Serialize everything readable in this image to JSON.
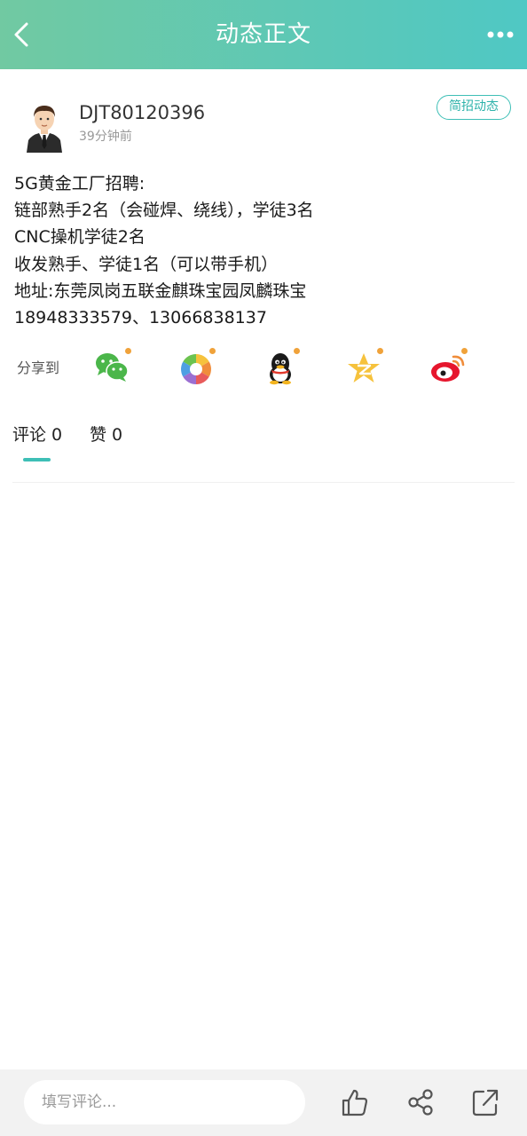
{
  "header": {
    "title": "动态正文",
    "back_icon": "chevron-left-icon",
    "more_icon": "more-dots-icon"
  },
  "post": {
    "author": "DJT80120396",
    "time": "39分钟前",
    "tag": "简招动态",
    "lines": [
      "5G黄金工厂招聘:",
      "链部熟手2名（会碰焊、绕线），学徒3名",
      "CNC操机学徒2名",
      "收发熟手、学徒1名（可以带手机）",
      "地址:东莞凤岗五联金麒珠宝园凤麟珠宝",
      "18948333579、13066838137"
    ]
  },
  "share": {
    "label": "分享到",
    "targets": [
      "wechat-icon",
      "moments-icon",
      "qq-icon",
      "qzone-icon",
      "weibo-icon"
    ]
  },
  "tabs": {
    "comments": "评论 0",
    "likes": "赞 0"
  },
  "bottom_bar": {
    "comment_placeholder": "填写评论...",
    "icons": [
      "thumbs-up-icon",
      "share-nodes-icon",
      "external-share-icon"
    ]
  },
  "colors": {
    "header_gradient_start": "#71c9a2",
    "header_gradient_end": "#4fc8c4",
    "accent": "#3ebfb6",
    "share_dot": "#f0a23a"
  }
}
